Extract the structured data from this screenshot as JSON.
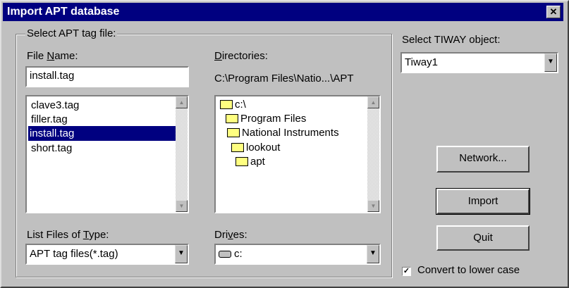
{
  "window": {
    "title": "Import APT database",
    "close_glyph": "✕"
  },
  "group": {
    "legend": "Select APT tag file:"
  },
  "file_name": {
    "label_pre": "File ",
    "label_u": "N",
    "label_post": "ame:",
    "value": "install.tag"
  },
  "file_list": {
    "items": [
      "clave3.tag",
      "filler.tag",
      "install.tag",
      "short.tag"
    ],
    "selected": "install.tag"
  },
  "directories": {
    "label_u": "D",
    "label_post": "irectories:",
    "path": "C:\\Program Files\\Natio...\\APT",
    "items": [
      "c:\\",
      "Program Files",
      "National Instruments",
      "lookout",
      "apt"
    ]
  },
  "file_type": {
    "label_pre": "List Files of ",
    "label_u": "T",
    "label_post": "ype:",
    "value": "APT tag files(*.tag)"
  },
  "drives": {
    "label_pre": "Dri",
    "label_u": "v",
    "label_post": "es:",
    "value": "c:"
  },
  "tiway": {
    "label": "Select TIWAY object:",
    "value": "Tiway1"
  },
  "buttons": {
    "network": "Network...",
    "import": "Import",
    "quit": "Quit"
  },
  "convert": {
    "label": "Convert to lower case",
    "checked": true,
    "check_glyph": "✓"
  },
  "icons": {
    "up": "scroll-up-arrow",
    "down": "scroll-down-arrow",
    "dropdown": "dropdown-arrow",
    "folder": "folder-icon",
    "drive": "drive-icon"
  }
}
